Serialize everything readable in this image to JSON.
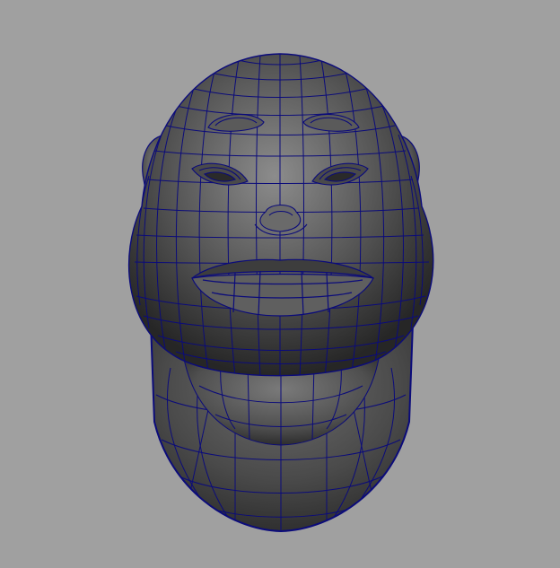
{
  "viewport": {
    "background": "#a0a0a0",
    "object": "head-mesh",
    "display_mode": "smooth-shaded-with-wireframe",
    "wire_color": "#0b0b7a",
    "shade_light": "#8a8a8a",
    "shade_dark": "#1e1e1e"
  }
}
